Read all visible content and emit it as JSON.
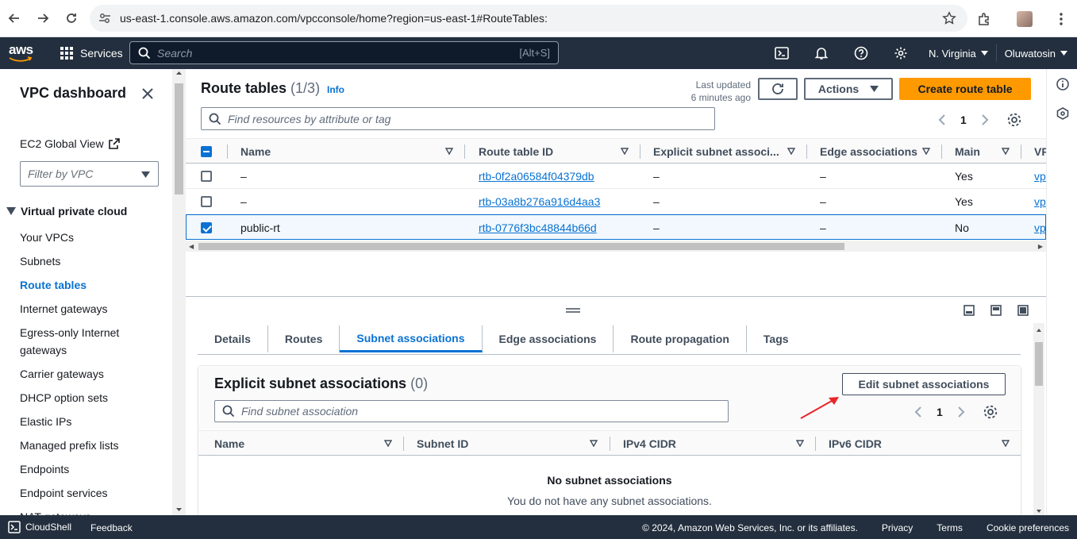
{
  "browser": {
    "url": "us-east-1.console.aws.amazon.com/vpcconsole/home?region=us-east-1#RouteTables:"
  },
  "aws_nav": {
    "logo": "aws",
    "services_label": "Services",
    "search_placeholder": "Search",
    "search_shortcut": "[Alt+S]",
    "region": "N. Virginia",
    "user": "Oluwatosin"
  },
  "sidebar": {
    "title": "VPC dashboard",
    "ec2_global_view": "EC2 Global View",
    "filter_placeholder": "Filter by VPC",
    "section": "Virtual private cloud",
    "items": [
      {
        "label": "Your VPCs",
        "active": false
      },
      {
        "label": "Subnets",
        "active": false
      },
      {
        "label": "Route tables",
        "active": true
      },
      {
        "label": "Internet gateways",
        "active": false
      },
      {
        "label": "Egress-only Internet gateways",
        "active": false
      },
      {
        "label": "Carrier gateways",
        "active": false
      },
      {
        "label": "DHCP option sets",
        "active": false
      },
      {
        "label": "Elastic IPs",
        "active": false
      },
      {
        "label": "Managed prefix lists",
        "active": false
      },
      {
        "label": "Endpoints",
        "active": false
      },
      {
        "label": "Endpoint services",
        "active": false
      },
      {
        "label": "NAT gateways",
        "active": false
      }
    ]
  },
  "route_tables": {
    "title": "Route tables",
    "count": "(1/3)",
    "info": "Info",
    "last_updated_line1": "Last updated",
    "last_updated_line2": "6 minutes ago",
    "actions_label": "Actions",
    "create_label": "Create route table",
    "search_placeholder": "Find resources by attribute or tag",
    "page": "1",
    "columns": [
      "Name",
      "Route table ID",
      "Explicit subnet associ...",
      "Edge associations",
      "Main",
      "VP"
    ],
    "rows": [
      {
        "name": "–",
        "id": "rtb-0f2a06584f04379db",
        "explicit": "–",
        "edge": "–",
        "main": "Yes",
        "vpc": "vp",
        "selected": false
      },
      {
        "name": "–",
        "id": "rtb-03a8b276a916d4aa3",
        "explicit": "–",
        "edge": "–",
        "main": "Yes",
        "vpc": "vp",
        "selected": false
      },
      {
        "name": "public-rt",
        "id": "rtb-0776f3bc48844b66d",
        "explicit": "–",
        "edge": "–",
        "main": "No",
        "vpc": "vp",
        "selected": true
      }
    ]
  },
  "details": {
    "tabs": [
      {
        "label": "Details",
        "active": false
      },
      {
        "label": "Routes",
        "active": false
      },
      {
        "label": "Subnet associations",
        "active": true
      },
      {
        "label": "Edge associations",
        "active": false
      },
      {
        "label": "Route propagation",
        "active": false
      },
      {
        "label": "Tags",
        "active": false
      }
    ],
    "assoc_title": "Explicit subnet associations",
    "assoc_count": "(0)",
    "edit_label": "Edit subnet associations",
    "search_placeholder": "Find subnet association",
    "page": "1",
    "columns": [
      "Name",
      "Subnet ID",
      "IPv4 CIDR",
      "IPv6 CIDR"
    ],
    "empty_title": "No subnet associations",
    "empty_sub": "You do not have any subnet associations."
  },
  "footer": {
    "cloudshell": "CloudShell",
    "feedback": "Feedback",
    "copyright": "© 2024, Amazon Web Services, Inc. or its affiliates.",
    "privacy": "Privacy",
    "terms": "Terms",
    "cookies": "Cookie preferences"
  },
  "colors": {
    "aws_nav": "#232f3e",
    "accent": "#0972d3",
    "primary_button": "#ff9900",
    "annotation_arrow": "#e8262a"
  }
}
